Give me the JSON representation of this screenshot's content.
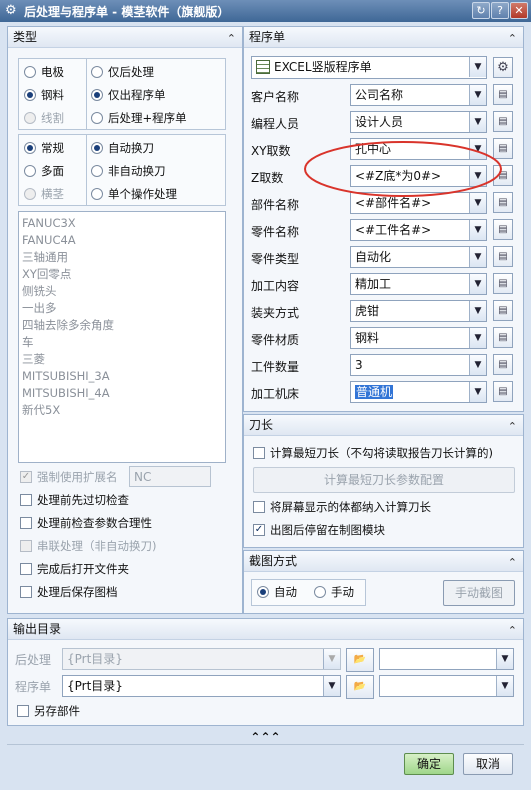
{
  "window": {
    "title": "后处理与程序单 - 模茎软件（旗舰版）",
    "btn_refresh": "↻",
    "btn_help": "?",
    "btn_close": "✕"
  },
  "left": {
    "header": "类型",
    "radio_col1": [
      "电极",
      "钢料",
      "线割"
    ],
    "radio_col2": [
      "仅后处理",
      "仅出程序单",
      "后处理+程序单"
    ],
    "radio2_col1": [
      "常规",
      "多面",
      "横茎"
    ],
    "radio2_col2": [
      "自动换刀",
      "非自动换刀",
      "单个操作处理"
    ],
    "machines": [
      "FANUC3X",
      "FANUC4A",
      "三轴通用",
      "XY回零点",
      "侧铣头",
      "一出多",
      "四轴去除多余角度",
      "车",
      "三菱",
      "MITSUBISHI_3A",
      "MITSUBISHI_4A",
      "新代5X"
    ],
    "force_ext_label": "强制使用扩展名",
    "force_ext_value": "NC",
    "checks": [
      "处理前先过切检查",
      "处理前检查参数合理性",
      "串联处理（非自动换刀)",
      "完成后打开文件夹",
      "处理后保存图档"
    ]
  },
  "right": {
    "header": "程序单",
    "template": "EXCEL竖版程序单",
    "fields": [
      {
        "label": "客户名称",
        "value": "公司名称"
      },
      {
        "label": "编程人员",
        "value": "设计人员"
      },
      {
        "label": "XY取数",
        "value": "孔中心"
      },
      {
        "label": "Z取数",
        "value": "<#Z底*为0#>"
      },
      {
        "label": "部件名称",
        "value": "<#部件名#>"
      },
      {
        "label": "零件名称",
        "value": "<#工件名#>"
      },
      {
        "label": "零件类型",
        "value": "自动化"
      },
      {
        "label": "加工内容",
        "value": "精加工"
      },
      {
        "label": "装夹方式",
        "value": "虎钳"
      },
      {
        "label": "零件材质",
        "value": "钢料"
      },
      {
        "label": "工件数量",
        "value": "3"
      },
      {
        "label": "加工机床",
        "value": "普通机"
      }
    ]
  },
  "tool": {
    "header": "刀长",
    "calc_shortest": "计算最短刀长（不勾将读取报告刀长计算的)",
    "cfg_btn": "计算最短刀长参数配置",
    "include_body": "将屏幕显示的体都纳入计算刀长",
    "stay_drawing": "出图后停留在制图模块"
  },
  "shot": {
    "header": "截图方式",
    "auto": "自动",
    "manual": "手动",
    "manual_btn": "手动截图"
  },
  "output": {
    "header": "输出目录",
    "post_label": "后处理",
    "post_value": "{Prt目录}",
    "prog_label": "程序单",
    "prog_value": "{Prt目录}",
    "save_part": "另存部件"
  },
  "bottom": {
    "collapse": "⌃⌃⌃",
    "ok": "确定",
    "cancel": "取消"
  },
  "colors": {
    "accent": "#3f6796",
    "highlight_circle": "#d9342b",
    "selected_bg": "#3375d6"
  }
}
